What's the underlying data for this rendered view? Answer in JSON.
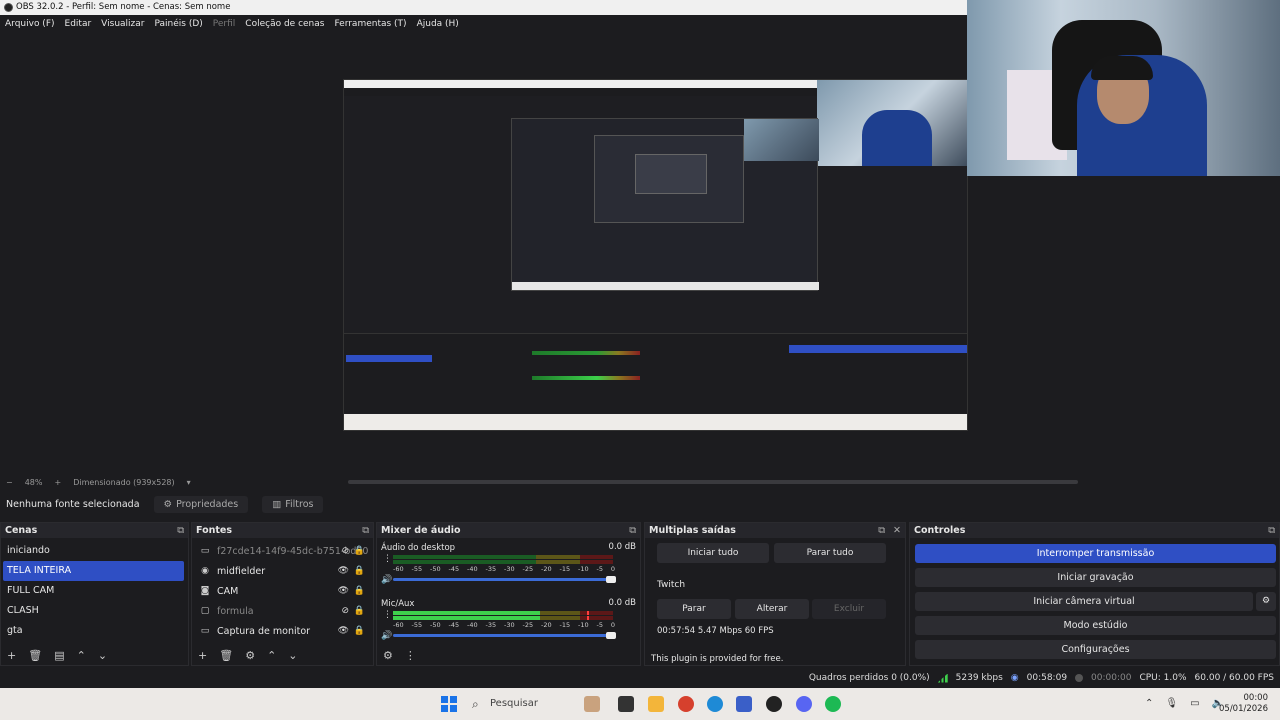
{
  "window": {
    "title": "OBS 32.0.2 - Perfil: Sem nome - Cenas: Sem nome"
  },
  "menu": {
    "items": [
      "Arquivo (F)",
      "Editar",
      "Visualizar",
      "Painéis (D)",
      "Perfil",
      "Coleção de cenas",
      "Ferramentas (T)",
      "Ajuda (H)"
    ]
  },
  "zoom": {
    "percent": "48%",
    "mode": "Dimensionado (939x528)"
  },
  "properties_bar": {
    "no_source": "Nenhuma fonte selecionada",
    "properties": "Propriedades",
    "filters": "Filtros"
  },
  "scenes": {
    "title": "Cenas",
    "items": [
      "iniciando",
      "TELA INTEIRA",
      "FULL CAM",
      "CLASH",
      "gta"
    ],
    "selected_index": 1
  },
  "sources": {
    "title": "Fontes",
    "items": [
      {
        "name": "f27cde14-14f9-45dc-b751-bd50",
        "icon": "monitor-icon",
        "dim": true
      },
      {
        "name": "midfielder",
        "icon": "browser-icon",
        "dim": false
      },
      {
        "name": "CAM",
        "icon": "camera-icon",
        "dim": false
      },
      {
        "name": "formula",
        "icon": "window-icon",
        "dim": true
      },
      {
        "name": "Captura de monitor",
        "icon": "monitor-icon",
        "dim": false
      }
    ]
  },
  "mixer": {
    "title": "Mixer de áudio",
    "scale": [
      "-60",
      "-55",
      "-50",
      "-45",
      "-40",
      "-35",
      "-30",
      "-25",
      "-20",
      "-15",
      "-10",
      "-5",
      "0"
    ],
    "channels": [
      {
        "name": "Áudio do desktop",
        "db": "0.0 dB",
        "level1": 0.0,
        "level2": 0.0,
        "peak": 0.0
      },
      {
        "name": "Mic/Aux",
        "db": "0.0 dB",
        "level1": 0.67,
        "level2": 0.67,
        "peak": 0.88
      }
    ]
  },
  "multi_output": {
    "title": "Multiplas saídas",
    "start_all": "Iniciar tudo",
    "stop_all": "Parar tudo",
    "target_name": "Twitch",
    "stop": "Parar",
    "edit": "Alterar",
    "delete": "Excluir",
    "stats": "00:57:54  5.47 Mbps  60 FPS",
    "plugin_note": "This plugin is provided for free."
  },
  "controls": {
    "title": "Controles",
    "stop_stream": "Interromper transmissão",
    "start_recording": "Iniciar gravação",
    "start_virtual_cam": "Iniciar câmera virtual",
    "studio_mode": "Modo estúdio",
    "settings": "Configurações"
  },
  "status": {
    "dropped_frames": "Quadros perdidos 0 (0.0%)",
    "bitrate": "5239 kbps",
    "stream_time": "00:58:09",
    "rec_time": "00:00:00",
    "cpu": "CPU: 1.0%",
    "fps": "60.00 / 60.00 FPS"
  },
  "taskbar": {
    "search_placeholder": "Pesquisar",
    "time": "00:00",
    "date": "05/01/2026"
  },
  "colors": {
    "accent": "#2f4fc4",
    "background": "#1c1c1f",
    "meter_green": "#3ed14c"
  }
}
